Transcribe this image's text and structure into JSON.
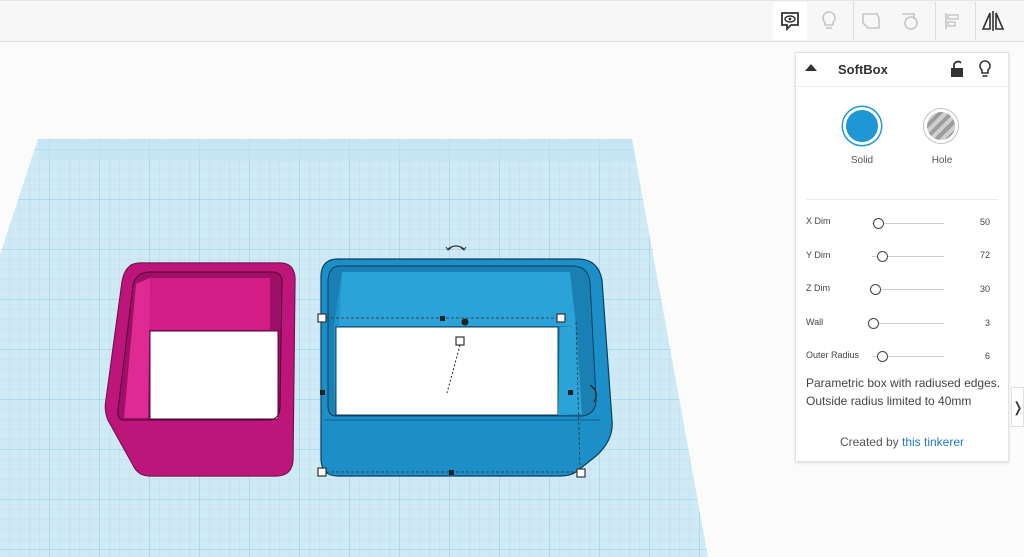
{
  "toolbar": {
    "tools": [
      "show-all-icon",
      "lightbulb-icon",
      "notes-icon",
      "group-icon",
      "align-icon",
      "mirror-icon"
    ]
  },
  "inspector": {
    "title": "SoftBox",
    "types": {
      "solid_label": "Solid",
      "hole_label": "Hole",
      "solid_color": "#1f97d4"
    },
    "params": [
      {
        "label": "X Dim",
        "value": "50",
        "level": 0.06
      },
      {
        "label": "Y Dim",
        "value": "72",
        "level": 0.09,
        "prefix": "-"
      },
      {
        "label": "Z Dim",
        "value": "30",
        "level": 0.03
      },
      {
        "label": "Wall",
        "value": "3",
        "level": 0.0
      },
      {
        "label": "Outer Radius",
        "value": "6",
        "level": 0.08,
        "prefix": "-"
      }
    ],
    "description": "Parametric box with radiused edges. Outside radius limited to 40mm",
    "credit_prefix": "Created by",
    "credit_link": "this tinkerer"
  },
  "scene": {
    "shapes": [
      {
        "name": "magenta-box",
        "color": "#c8187f"
      },
      {
        "name": "softbox",
        "color": "#1f97d4",
        "selected": true
      }
    ]
  },
  "side_tab": "❭"
}
